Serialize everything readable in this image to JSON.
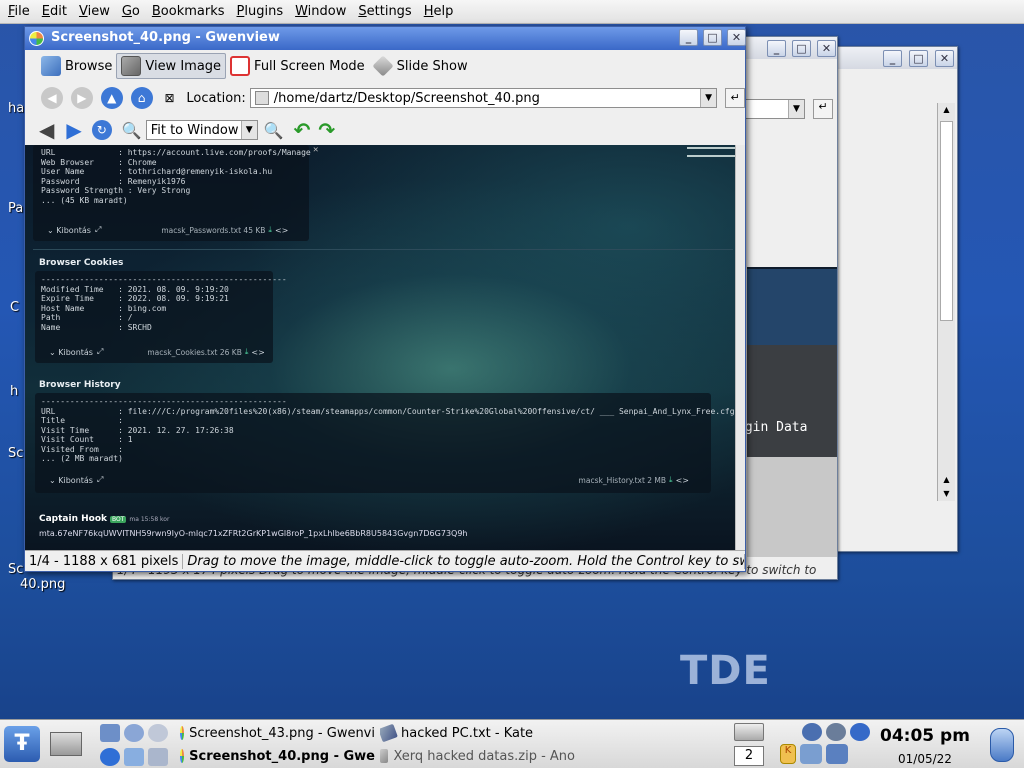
{
  "menubar": {
    "items": [
      {
        "label": "File",
        "u": "F"
      },
      {
        "label": "Edit",
        "u": "E"
      },
      {
        "label": "View",
        "u": "V"
      },
      {
        "label": "Go",
        "u": "G"
      },
      {
        "label": "Bookmarks",
        "u": "B"
      },
      {
        "label": "Plugins",
        "u": "P"
      },
      {
        "label": "Window",
        "u": "W"
      },
      {
        "label": "Settings",
        "u": "S"
      },
      {
        "label": "Help",
        "u": "H"
      }
    ]
  },
  "desktop": {
    "icon_labels": [
      "ha",
      "Pa",
      "C",
      "h",
      "Sc",
      "Sc",
      "40.png"
    ],
    "bg_window_text": "ogin Data",
    "bg_status_text": "1/4 - 1193 x 174 pixels  Drag to move the image, middle-click to toggle auto-zoom. Hold the Control key to switch to"
  },
  "gwenview": {
    "title": "Screenshot_40.png - Gwenview",
    "toolbar": {
      "browse": "Browse",
      "view_image": "View Image",
      "full_screen": "Full Screen Mode",
      "slide_show": "Slide Show"
    },
    "location_label": "Location:",
    "location_value": "/home/dartz/Desktop/Screenshot_40.png",
    "zoom_value": "Fit to Window",
    "status_size": "1/4 - 1188 x 681 pixels",
    "status_hint": "Drag to move the image, middle-click to toggle auto-zoom. Hold the Control key to switch to"
  },
  "image": {
    "passwords": {
      "lines": "URL             : https://account.live.com/proofs/Manage\nWeb Browser     : Chrome\nUser Name       : tothrichard@remenyik-iskola.hu\nPassword        : Remenyik1976\nPassword Strength : Very Strong\n... (45 KB maradt)",
      "expand": "Kibontás",
      "file": "macsk_Passwords.txt 45 KB"
    },
    "cookies": {
      "title": "Browser Cookies",
      "lines": "---------------------------------------------------\nModified Time   : 2021. 08. 09. 9:19:20\nExpire Time     : 2022. 08. 09. 9:19:21\nHost Name       : bing.com\nPath            : /\nName            : SRCHD",
      "expand": "Kibontás",
      "file": "macsk_Cookies.txt 26 KB"
    },
    "history": {
      "title": "Browser History",
      "lines": "---------------------------------------------------\nURL             : file:///C:/program%20files%20(x86)/steam/steamapps/common/Counter-Strike%20Global%20Offensive/ct/ ___ Senpai_And_Lynx_Free.cfg\nTitle           :\nVisit Time      : 2021. 12. 27. 17:26:38\nVisit Count     : 1\nVisited From    :\n... (2 MB maradt)",
      "expand": "Kibontás",
      "file": "macsk_History.txt 2 MB"
    },
    "bot": {
      "name": "Captain Hook",
      "badge": "BOT",
      "meta": "ma 15:58 kor",
      "line": "mta.67eNF76kqUWVITNH59rwn9IyO-mIqc71xZFRt2GrKP1wGl8roP_1pxLhlbe6BbR8U5843Gvgn7D6G73Q9h"
    }
  },
  "tde_logo": "TDE",
  "taskbar": {
    "tasks": [
      {
        "label": "Screenshot_43.png - Gwenvi",
        "bold": false
      },
      {
        "label": "hacked PC.txt - Kate",
        "bold": false
      },
      {
        "label": "Screenshot_40.png - Gwe",
        "bold": true
      },
      {
        "label": "Xerq hacked datas.zip - Ano",
        "bold": false
      }
    ],
    "desktop_num": "2",
    "clock_time": "04:05 pm",
    "clock_date": "01/05/22"
  }
}
